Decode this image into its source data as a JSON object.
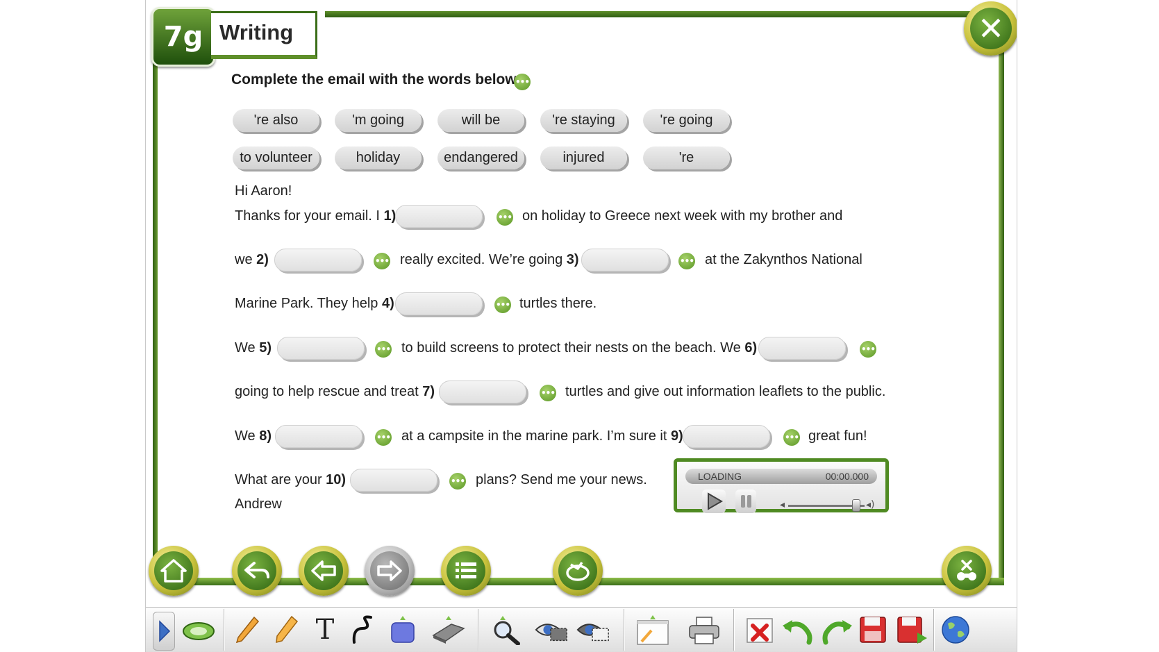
{
  "header": {
    "lesson_code": "7g",
    "title": "Writing"
  },
  "instruction": "Complete the email with the words below.",
  "word_bank": [
    "'re also",
    "'m going",
    "will be",
    "'re staying",
    "'re going",
    "to volunteer",
    "holiday",
    "endangered",
    "injured",
    "'re"
  ],
  "email": {
    "greeting": "Hi Aaron!",
    "line1_a": "Thanks for your email. I",
    "line1_b": "on holiday to Greece next week with my brother and",
    "line2_a": "we",
    "line2_b": "really excited. We’re going",
    "line2_c": "at the Zakynthos National",
    "line3_a": "Marine Park. They help",
    "line3_b": "turtles there.",
    "line4_a": "We",
    "line4_b": "to build screens to protect their nests on the beach. We",
    "line5_a": "going to help rescue and treat",
    "line5_b": "turtles and give out information leaflets to the public.",
    "line6_a": "We",
    "line6_b": "at a campsite in the marine park. I’m sure it",
    "line6_c": "great fun!",
    "line7_a": "What are your",
    "line7_b": "plans? Send me your news.",
    "signature": "Andrew",
    "gap_numbers": [
      "1)",
      "2)",
      "3)",
      "4)",
      "5)",
      "6)",
      "7)",
      "8)",
      "9)",
      "10)"
    ]
  },
  "audio_dot_glyph": "•••",
  "audio_player": {
    "status": "LOADING",
    "time": "00:00.000"
  },
  "colors": {
    "frame_green": "#3a6e18",
    "button_green": "#5a9624",
    "button_gold": "#c9c23c"
  },
  "nav_icons": [
    "home-icon",
    "back-icon",
    "previous-icon",
    "next-icon",
    "menu-icon",
    "reload-icon",
    "tools-icon"
  ],
  "toolbar_icons": [
    "arrow-icon",
    "mouse-icon",
    "pencil-icon",
    "highlighter-icon",
    "text-icon",
    "curve-icon",
    "shape-icon",
    "eraser-icon",
    "magnifier-icon",
    "spotlight-icon",
    "reveal-icon",
    "note-icon",
    "printer-icon",
    "delete-icon",
    "undo-icon",
    "redo-icon",
    "save-icon",
    "save-as-icon",
    "globe-icon"
  ],
  "toolbar_text_glyph": "T"
}
